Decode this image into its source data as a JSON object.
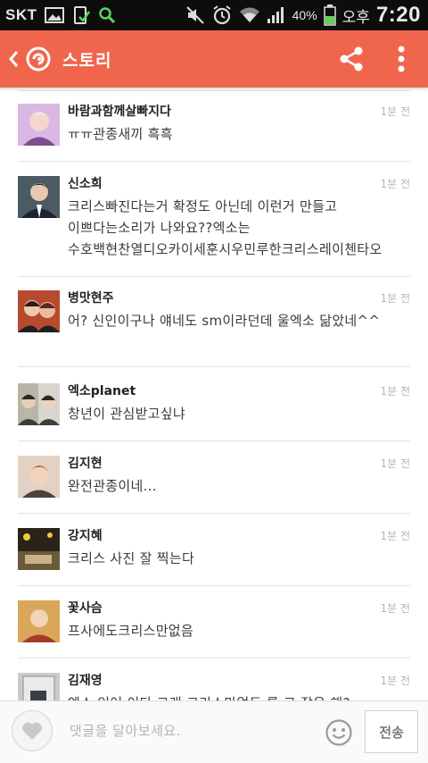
{
  "status_bar": {
    "carrier": "SKT",
    "battery_percent": "40%",
    "ampm": "오후",
    "time": "7:20",
    "icons": [
      "image-icon",
      "download-icon",
      "search-icon",
      "mute-icon",
      "alarm-icon",
      "wifi-icon",
      "signal-icon",
      "battery-icon"
    ]
  },
  "app_bar": {
    "title": "스토리",
    "background": "#f0664c"
  },
  "comments": [
    {
      "name": "바람과함께살빠지다",
      "time": "1분 전",
      "text": "ㅠㅠ관종새끼 흑흑",
      "avatar_color": "#c79ad0"
    },
    {
      "name": "신소희",
      "time": "1분 전",
      "text": "크리스빠진다는거 확정도 아닌데 이런거 만들고 이쁘다는소리가 나와요??엑소는 수호백현찬열디오카이세훈시우민루한크리스레이첸타오",
      "avatar_color": "#27313a"
    },
    {
      "name": "병맛현주",
      "time": "1분 전",
      "text": "어? 신인이구나 얘네도 sm이라던데 울엑소 닮았네^^",
      "avatar_color": "#8a3a2c"
    },
    {
      "name": "엑소planet",
      "time": "1분 전",
      "text": "창년이 관심받고싶냐",
      "avatar_color": "#6d6a5c"
    },
    {
      "name": "김지현",
      "time": "1분 전",
      "text": "완전관종이네...",
      "avatar_color": "#b08a72"
    },
    {
      "name": "강지혜",
      "time": "1분 전",
      "text": "크리스 사진 잘 찍는다",
      "avatar_color": "#3a3320"
    },
    {
      "name": "꽃사슴",
      "time": "1분 전",
      "text": "프사에도크리스만없음",
      "avatar_color": "#b4833c"
    },
    {
      "name": "김재영",
      "time": "1분 전",
      "text": "엑소 있어 이다 그래 크리스만없도 를 고 잡은 해?",
      "avatar_color": "#8b8e92"
    }
  ],
  "input_bar": {
    "placeholder": "댓글을 달아보세요.",
    "send_label": "전송"
  }
}
